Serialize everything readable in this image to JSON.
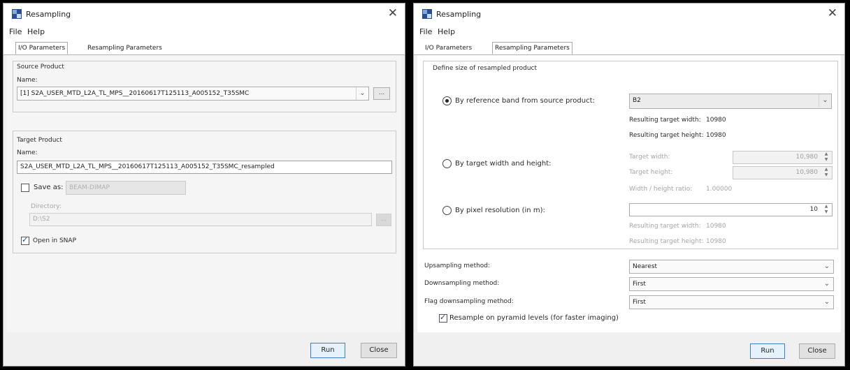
{
  "left_dialog": {
    "title": "Resampling",
    "close_glyph": "✕",
    "menu": {
      "file": "File",
      "help": "Help"
    },
    "tabs": {
      "io": "I/O Parameters",
      "resampling": "Resampling Parameters"
    },
    "source": {
      "group_title": "Source Product",
      "name_label": "Name:",
      "value": "[1] S2A_USER_MTD_L2A_TL_MPS__20160617T125113_A005152_T35SMC",
      "browse": "..."
    },
    "target": {
      "group_title": "Target Product",
      "name_label": "Name:",
      "value": "S2A_USER_MTD_L2A_TL_MPS__20160617T125113_A005152_T35SMC_resampled",
      "save_as_label": "Save as:",
      "format_value": "BEAM-DIMAP",
      "directory_label": "Directory:",
      "directory_value": "D:\\S2",
      "browse": "...",
      "open_in_snap": "Open in SNAP"
    },
    "buttons": {
      "run": "Run",
      "close": "Close"
    }
  },
  "right_dialog": {
    "title": "Resampling",
    "close_glyph": "✕",
    "menu": {
      "file": "File",
      "help": "Help"
    },
    "tabs": {
      "io": "I/O Parameters",
      "resampling": "Resampling Parameters"
    },
    "define_size": {
      "group_title": "Define size of resampled product",
      "by_reference": {
        "label": "By reference band from source product:",
        "band_value": "B2",
        "width_label": "Resulting target width:",
        "width_value": "10980",
        "height_label": "Resulting target height:",
        "height_value": "10980"
      },
      "by_width_height": {
        "label": "By target width and height:",
        "target_width_label": "Target width:",
        "target_width_value": "10,980",
        "target_height_label": "Target height:",
        "target_height_value": "10,980",
        "ratio_label": "Width / height ratio:",
        "ratio_value": "1.00000"
      },
      "by_pixel_res": {
        "label": "By pixel resolution (in m):",
        "value": "10",
        "width_label": "Resulting target width:",
        "width_value": "10980",
        "height_label": "Resulting target height:",
        "height_value": "10980"
      }
    },
    "methods": {
      "upsampling_label": "Upsampling method:",
      "upsampling_value": "Nearest",
      "downsampling_label": "Downsampling method:",
      "downsampling_value": "First",
      "flag_label": "Flag downsampling method:",
      "flag_value": "First"
    },
    "pyramid_label": "Resample on pyramid levels (for faster imaging)",
    "buttons": {
      "run": "Run",
      "close": "Close"
    }
  }
}
